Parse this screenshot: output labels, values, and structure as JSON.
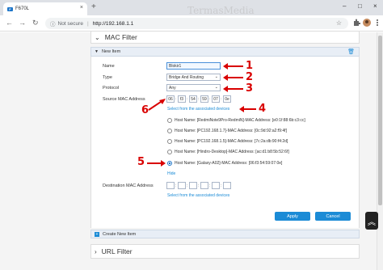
{
  "browser": {
    "tab_title": "F670L",
    "tab_close": "×",
    "new_tab": "+",
    "security_label": "Not secure",
    "url": "http://192.168.1.1",
    "minimize": "–",
    "maximize": "□",
    "close": "×",
    "back": "←",
    "forward": "→",
    "reload": "↻",
    "bookmark": "☆"
  },
  "watermark": "TermasMedia",
  "sections": {
    "mac_filter": "MAC Filter",
    "url_filter": "URL Filter"
  },
  "new_item": {
    "header": "New Item",
    "name_label": "Name",
    "name_value": "Blokir1",
    "type_label": "Type",
    "type_value": "Bridge And Routing",
    "protocol_label": "Protocol",
    "protocol_value": "Any",
    "source_mac_label": "Source MAC Address",
    "source_mac": [
      "06",
      "f3",
      "54",
      "59",
      "07",
      "0e"
    ],
    "select_link": "Select from the associated devices",
    "hosts": [
      "Host Name: [RedmiNote9Pro-RedmiN]-MAC Address: [e0:1f:88:6b:c3:cc]",
      "Host Name: [PC192.168.1.7]-MAC Address: [0c:9d:92:a2:f9:4f]",
      "Host Name: [PC192.168.1.5]-MAC Address: [7c:2a:db:90:f4:2d]",
      "Host Name: [Hindro-Desktop]-MAC Address: [ac:d1:b8:5b:52:6f]",
      "Host Name: [Galaxy-A02]-MAC Address: [06:f3:54:59:07:0e]"
    ],
    "selected_host_index": 4,
    "hide_link": "Hide",
    "dest_mac_label": "Destination MAC Address",
    "dest_mac": [
      "",
      "",
      "",
      "",
      "",
      ""
    ],
    "dest_select_link": "Select from the associated devices",
    "apply": "Apply",
    "cancel": "Cancel"
  },
  "create_new_item": "Create New Item",
  "annotations": [
    "1",
    "2",
    "3",
    "4",
    "5",
    "6"
  ],
  "colors": {
    "accent": "#1b8bd6",
    "annotation": "#d90000"
  }
}
